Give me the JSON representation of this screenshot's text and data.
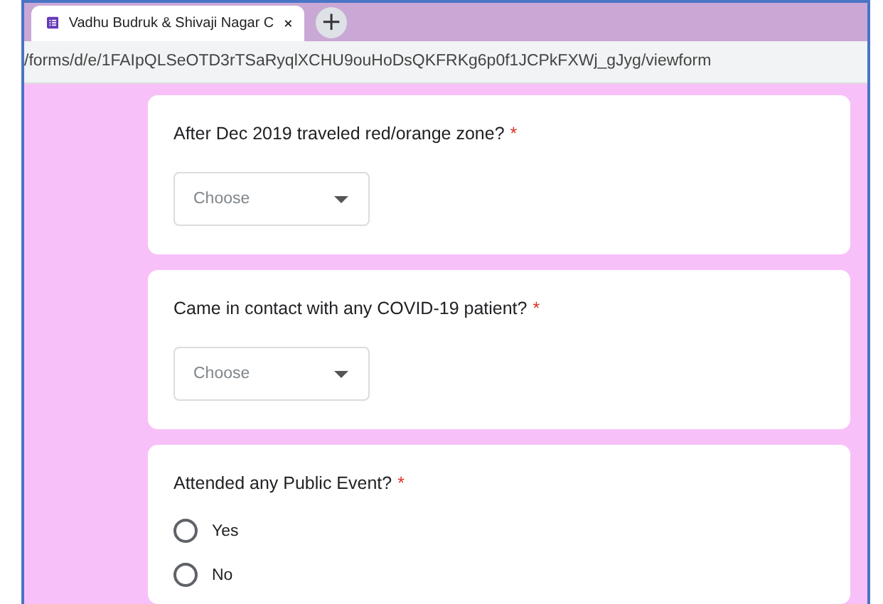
{
  "tab": {
    "title": "Vadhu Budruk & Shivaji Nagar C",
    "new_tab": "+"
  },
  "address_bar": {
    "url": "/forms/d/e/1FAIpQLSeOTD3rTSaRyqlXCHU9ouHoDsQKFRKg6p0f1JCPkFXWj_gJyg/viewform"
  },
  "questions": [
    {
      "kind": "dropdown",
      "title": "After Dec 2019 traveled red/orange zone?",
      "required_mark": "*",
      "placeholder": "Choose"
    },
    {
      "kind": "dropdown",
      "title": "Came in contact with any COVID-19 patient?",
      "required_mark": "*",
      "placeholder": "Choose"
    },
    {
      "kind": "radio",
      "title": "Attended any Public Event?",
      "required_mark": "*",
      "options": [
        {
          "label": "Yes",
          "selected": false
        },
        {
          "label": "No",
          "selected": false
        }
      ]
    }
  ]
}
